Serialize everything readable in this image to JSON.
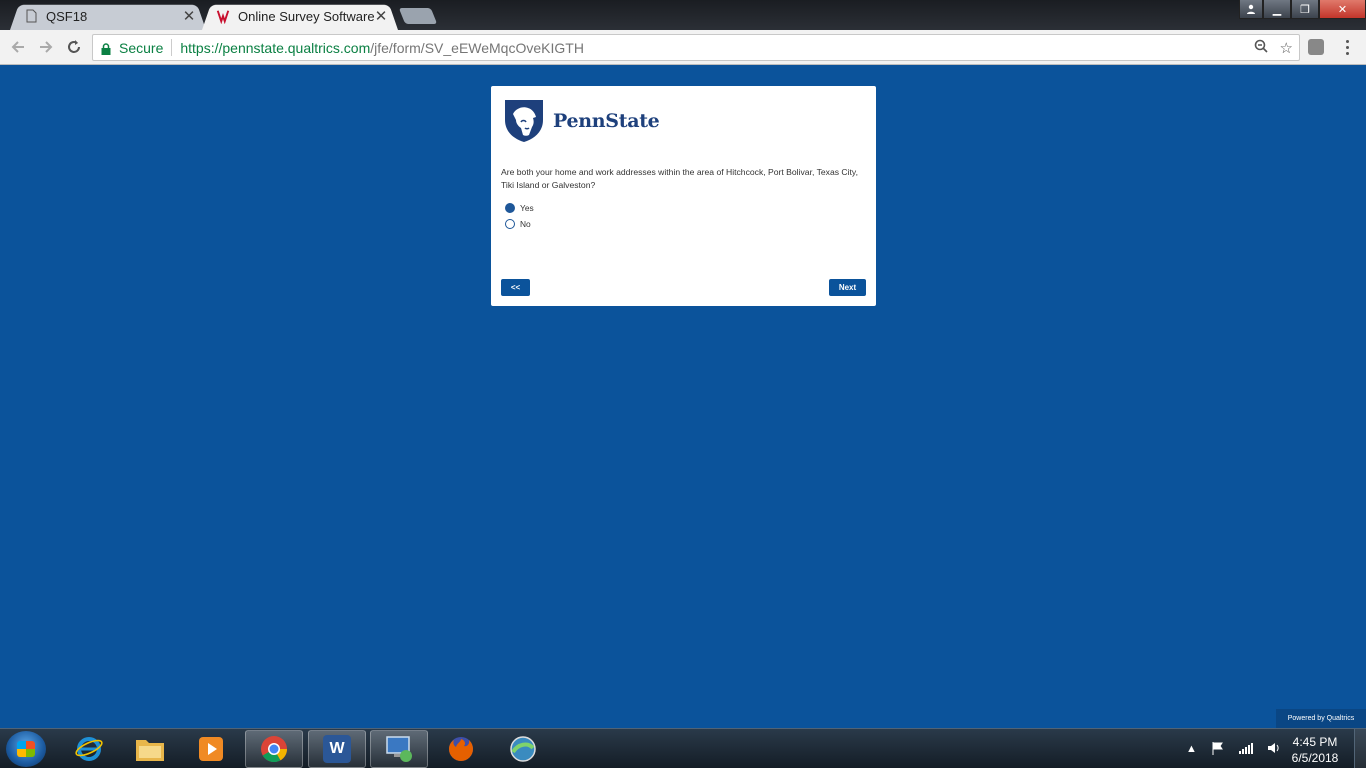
{
  "browser": {
    "tabs": [
      {
        "title": "QSF18",
        "active": false,
        "icon": "document-icon"
      },
      {
        "title": "Online Survey Software | Q",
        "active": true,
        "icon": "qualtrics-icon"
      }
    ],
    "address": {
      "secure_label": "Secure",
      "url_host": "https://pennstate.qualtrics.com",
      "url_path": "/jfe/form/SV_eEWeMqcOveKIGTH"
    }
  },
  "survey": {
    "logo_text": "PennState",
    "question": "Are both your home and work addresses within the area of Hitchcock, Port Bolivar, Texas City, Tiki Island or Galveston?",
    "choices": [
      {
        "label": "Yes",
        "selected": true
      },
      {
        "label": "No",
        "selected": false
      }
    ],
    "back_label": "<<",
    "next_label": "Next",
    "powered_by": "Powered by Qualtrics"
  },
  "taskbar": {
    "apps": [
      {
        "name": "internet-explorer",
        "color": "#1e90d6"
      },
      {
        "name": "file-explorer",
        "color": "#e8b64a"
      },
      {
        "name": "media-player",
        "color": "#f08a24"
      },
      {
        "name": "chrome",
        "color": "#db4437"
      },
      {
        "name": "word",
        "color": "#2b5797",
        "letter": "W"
      },
      {
        "name": "remote-desktop",
        "color": "#3a78c2"
      },
      {
        "name": "firefox",
        "color": "#e66000"
      },
      {
        "name": "network-app",
        "color": "#4a9a5a"
      }
    ],
    "time": "4:45 PM",
    "date": "6/5/2018"
  },
  "colors": {
    "page_background": "#0b539b",
    "penn_state_blue": "#1e407c",
    "button": "#0b539b"
  }
}
